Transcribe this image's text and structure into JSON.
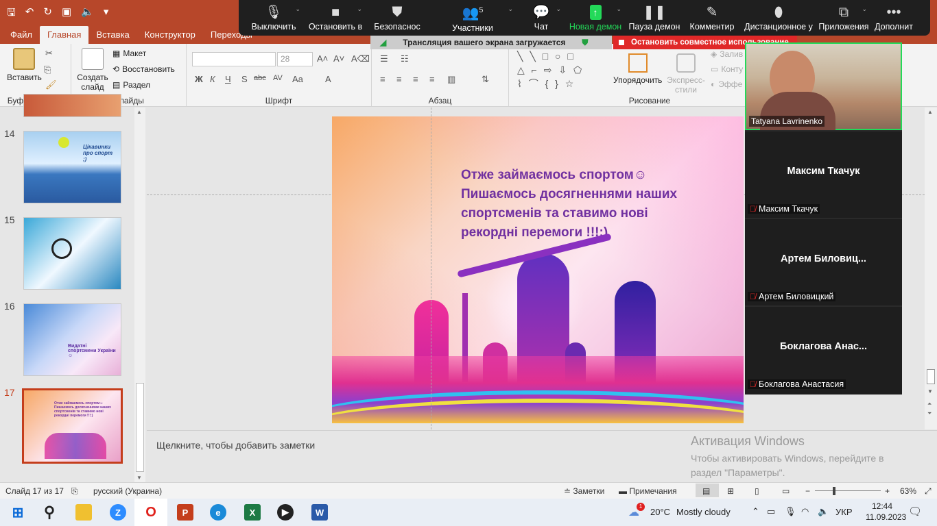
{
  "titlebar": {
    "qat": [
      "save-icon",
      "undo-icon",
      "redo-icon",
      "slideshow-icon",
      "speaker-icon",
      "more-icon"
    ]
  },
  "ribbon_tabs": [
    "Файл",
    "Главная",
    "Вставка",
    "Конструктор",
    "Переходы"
  ],
  "active_tab": "Главная",
  "ribbon": {
    "clipboard": {
      "paste": "Вставить",
      "label": "Буфер обмена"
    },
    "slides": {
      "new_slide": "Создать слайд",
      "layout": "Макет",
      "reset": "Восстановить",
      "section": "Раздел",
      "label": "Слайды"
    },
    "font": {
      "size": "28",
      "label": "Шрифт",
      "buttons": [
        "Ж",
        "К",
        "Ч",
        "S",
        "abc",
        "AV",
        "Aa",
        "A"
      ]
    },
    "paragraph": {
      "label": "Абзац"
    },
    "drawing": {
      "arrange": "Упорядочить",
      "quick_styles": "Экспресс-стили",
      "fill": "Залив",
      "outline": "Конту",
      "effects": "Эффе",
      "label": "Рисование"
    }
  },
  "zoom_toolbar": {
    "items": [
      {
        "label": "Выключить",
        "icon": "mic-icon"
      },
      {
        "label": "Остановить в",
        "icon": "video-icon"
      },
      {
        "label": "Безопаснос",
        "icon": "shield-icon"
      },
      {
        "label": "Участники",
        "icon": "participants-icon",
        "count": "5"
      },
      {
        "label": "Чат",
        "icon": "chat-icon"
      },
      {
        "label": "Новая демон",
        "icon": "share-icon"
      },
      {
        "label": "Пауза демон",
        "icon": "pause-icon"
      },
      {
        "label": "Комментир",
        "icon": "pen-icon"
      },
      {
        "label": "Дистанционное у",
        "icon": "mouse-icon"
      },
      {
        "label": "Приложения",
        "icon": "apps-icon"
      },
      {
        "label": "Дополнит",
        "icon": "more-icon"
      }
    ],
    "share_status": "Трансляция вашего экрана загружается",
    "stop_share": "Остановить совместное использование",
    "accent": "#23d959"
  },
  "thumbnails": [
    {
      "num": "14",
      "text": "Цікавинки про спорт ;)"
    },
    {
      "num": "15",
      "text": ""
    },
    {
      "num": "16",
      "text": "Видатні спортсмени України ☺"
    },
    {
      "num": "17",
      "text": "Отже займаємось спортом☺ Пишаємось досягненнями наших спортсменів та ставимо нові рекордні перемоги !!!;)"
    }
  ],
  "slide": {
    "text_line1": "Отже займаємось спортом☺",
    "text_line2": "Пишаємось досягненнями наших спортсменів та ставимо нові рекордні перемоги !!!;)",
    "text_color": "#7030a0"
  },
  "notes_placeholder": "Щелкните, чтобы добавить заметки",
  "watermark": {
    "title": "Активация Windows",
    "body": "Чтобы активировать Windows, перейдите в раздел \"Параметры\"."
  },
  "participants": [
    {
      "name": "Tatyana Lavrinenko",
      "video": true
    },
    {
      "name": "Максим Ткачук",
      "display": "Максим Ткачук",
      "muted": true
    },
    {
      "name": "Артем Биловицкий",
      "display": "Артем  Биловиц...",
      "muted": true
    },
    {
      "name": "Боклагова Анастасия",
      "display": "Боклагова  Анас...",
      "muted": true
    }
  ],
  "status": {
    "slide_info": "Слайд 17 из 17",
    "language": "русский (Украина)",
    "notes": "Заметки",
    "comments": "Примечания",
    "zoom": "63%",
    "zoom_level": 0.63
  },
  "taskbar": {
    "weather_temp": "20°C",
    "weather_desc": "Mostly cloudy",
    "weather_badge": "1",
    "lang": "УКР",
    "time": "12:44",
    "date": "11.09.2023"
  }
}
